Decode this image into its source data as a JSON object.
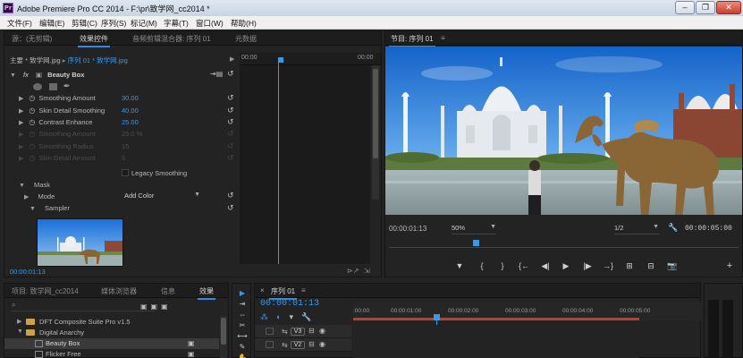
{
  "titlebar": {
    "app_icon": "Pr",
    "title": "Adobe Premiere Pro CC 2014 - F:\\pr\\致学网_cc2014 *",
    "minimize": "–",
    "maximize": "❐",
    "close": "✕"
  },
  "menubar": {
    "items": [
      "文件(F)",
      "编辑(E)",
      "剪辑(C)",
      "序列(S)",
      "标记(M)",
      "字幕(T)",
      "窗口(W)",
      "帮助(H)"
    ]
  },
  "left_panel": {
    "tabs": [
      "源：(无剪辑)",
      "效果控件",
      "音频剪辑混合器: 序列 01",
      "元数据"
    ],
    "active_tab": "效果控件",
    "menu": "≡",
    "breadcrumb_main": "主要 * 致学网.jpg",
    "breadcrumb_seq": "序列 01 * 致学网.jpg",
    "ruler_start": "00:00",
    "ruler_end": "00:00",
    "effect_name": "Beauty Box",
    "fx_label": "fx",
    "properties": [
      {
        "name": "Smoothing Amount",
        "value": "30.00",
        "enabled": true
      },
      {
        "name": "Skin Detail Smoothing",
        "value": "40.00",
        "enabled": true
      },
      {
        "name": "Contrast Enhance",
        "value": "25.00",
        "enabled": true
      },
      {
        "name": "Smoothing Amount",
        "value": "25.0 %",
        "enabled": false
      },
      {
        "name": "Smoothing Radius",
        "value": "15",
        "enabled": false
      },
      {
        "name": "Skin Detail Amount",
        "value": "5",
        "enabled": false
      }
    ],
    "legacy_label": "Legacy Smoothing",
    "mask_label": "Mask",
    "mode_label": "Mode",
    "mode_value": "Add Color",
    "sampler_label": "Sampler",
    "timecode": "00:00:01:13"
  },
  "program_monitor": {
    "tab_label": "节目: 序列 01",
    "menu": "≡",
    "timecode_current": "00:00:01:13",
    "zoom": "50%",
    "resolution": "1/2",
    "timecode_duration": "00:00:05:00",
    "playhead_fraction": 0.24,
    "controls": [
      "▼",
      "{",
      "}",
      "{←",
      "◀|",
      "▶",
      "|▶",
      "→}",
      "⊞",
      "⊟",
      "📷"
    ],
    "add_button": "+"
  },
  "project_panel": {
    "tabs": [
      "项目: 致学网_cc2014",
      "媒体浏览器",
      "信息",
      "效果"
    ],
    "active_tab": "效果",
    "menu": "≡",
    "items": [
      {
        "label": "DFT Composite Suite Pro v1.5",
        "indent": 1,
        "type": "folder",
        "expanded": false
      },
      {
        "label": "Digital Anarchy",
        "indent": 1,
        "type": "folder",
        "expanded": true
      },
      {
        "label": "Beauty Box",
        "indent": 2,
        "type": "effect",
        "selected": true
      },
      {
        "label": "Flicker Free",
        "indent": 2,
        "type": "effect",
        "selected": false
      }
    ]
  },
  "tools": [
    "▶",
    "⇥",
    "⇔",
    "✂",
    "⟷",
    "✎",
    "✋",
    "🔍"
  ],
  "timeline": {
    "tab_close": "×",
    "tab_label": "序列 01",
    "menu": "≡",
    "timecode": "00:00:01:13",
    "ruler_labels": [
      ":00:00",
      "00:00:01:00",
      "00:00:02:00",
      "00:00:03:00",
      "00:00:04:00",
      "00:00:05:00"
    ],
    "playhead_fraction": 0.29,
    "tracks": [
      {
        "name": "V3"
      },
      {
        "name": "V2"
      }
    ]
  },
  "colors": {
    "accent": "#2f9bf3",
    "panel_bg": "#232323",
    "selected_row": "#3a3a3a",
    "work_area": "#c83a2a"
  }
}
